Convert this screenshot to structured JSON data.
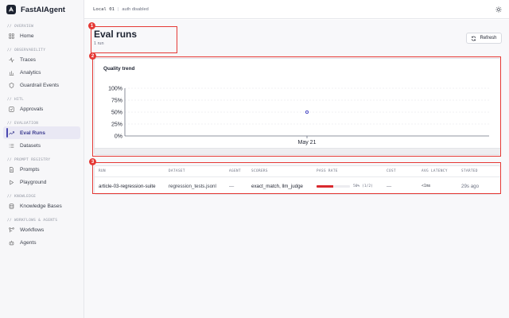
{
  "app": {
    "name": "FastAIAgent"
  },
  "topbar": {
    "env": "Local 01",
    "auth": "auth disabled"
  },
  "sidebar": {
    "sections": [
      {
        "label": "// OVERVIEW",
        "items": [
          {
            "label": "Home",
            "icon": "grid-icon"
          }
        ]
      },
      {
        "label": "// OBSERVABILITY",
        "items": [
          {
            "label": "Traces",
            "icon": "activity-icon"
          },
          {
            "label": "Analytics",
            "icon": "bar-chart-icon"
          },
          {
            "label": "Guardrail Events",
            "icon": "shield-icon"
          }
        ]
      },
      {
        "label": "// HITL",
        "items": [
          {
            "label": "Approvals",
            "icon": "check-square-icon"
          }
        ]
      },
      {
        "label": "// EVALUATION",
        "items": [
          {
            "label": "Eval Runs",
            "icon": "trend-icon",
            "active": true
          },
          {
            "label": "Datasets",
            "icon": "list-icon"
          }
        ]
      },
      {
        "label": "// PROMPT REGISTRY",
        "items": [
          {
            "label": "Prompts",
            "icon": "file-icon"
          },
          {
            "label": "Playground",
            "icon": "play-icon"
          }
        ]
      },
      {
        "label": "// KNOWLEDGE",
        "items": [
          {
            "label": "Knowledge Bases",
            "icon": "database-icon"
          }
        ]
      },
      {
        "label": "// WORKFLOWS & AGENTS",
        "items": [
          {
            "label": "Workflows",
            "icon": "workflow-icon"
          },
          {
            "label": "Agents",
            "icon": "bot-icon"
          }
        ]
      }
    ]
  },
  "page": {
    "title": "Eval runs",
    "subtitle": "1 run",
    "refresh_label": "Refresh"
  },
  "chart_data": {
    "type": "line",
    "title": "Quality trend",
    "categories": [
      "May 21"
    ],
    "series": [
      {
        "values": [
          50
        ]
      }
    ],
    "yticks": [
      "100%",
      "75%",
      "50%",
      "25%",
      "0%"
    ],
    "ylim": [
      0,
      100
    ],
    "grid": true,
    "point_color": "#3b3bbf"
  },
  "table": {
    "headers": [
      "RUN",
      "DATASET",
      "AGENT",
      "SCORERS",
      "PASS RATE",
      "COST",
      "AVG LATENCY",
      "STARTED"
    ],
    "rows": [
      {
        "run": "article-03-regression-suite",
        "dataset": "regression_tests.jsonl",
        "agent": "—",
        "scorers": "exact_match, llm_judge",
        "pass_rate": 50,
        "pass_text": "50% (1/2)",
        "cost": "—",
        "latency": "<1ms",
        "started": "29s ago"
      }
    ]
  },
  "annotations": [
    "1",
    "2",
    "3"
  ],
  "colors": {
    "accent": "#4a47b0",
    "fail": "#d9292e",
    "annotation": "#e53935"
  }
}
